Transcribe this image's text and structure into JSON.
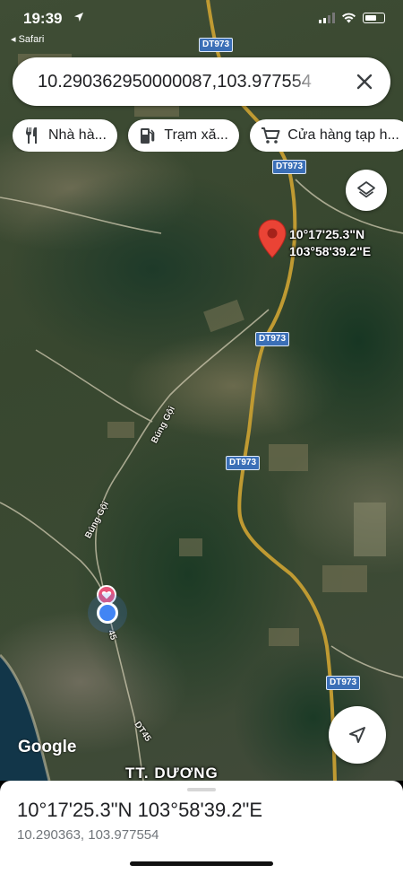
{
  "status_bar": {
    "time": "19:39",
    "back_app": "◂ Safari"
  },
  "search": {
    "query": "10.290362950000087,103.977554"
  },
  "chips": [
    {
      "icon": "utensils-icon",
      "label": "Nhà hà..."
    },
    {
      "icon": "fuel-pump-icon",
      "label": "Trạm xă..."
    },
    {
      "icon": "shopping-cart-icon",
      "label": "Cửa hàng tạp h..."
    }
  ],
  "map": {
    "pin_label_line1": "10°17'25.3\"N",
    "pin_label_line2": "103°58'39.2\"E",
    "road_labels": [
      "DT973",
      "DT973",
      "DT973",
      "DT973",
      "DT973"
    ],
    "street_labels": [
      "Búng Gội",
      "Búng Gội",
      "DT45",
      "45"
    ],
    "town_label": "TT. DƯƠNG",
    "attribution": "Google"
  },
  "bottom_sheet": {
    "title": "10°17'25.3\"N 103°58'39.2\"E",
    "subtitle": "10.290363, 103.977554"
  },
  "colors": {
    "pin": "#ea4335",
    "road": "#c9a23a",
    "road_badge": "#3b6fb7",
    "user_location": "#4285f4",
    "favorite_marker": "#e8547a"
  }
}
